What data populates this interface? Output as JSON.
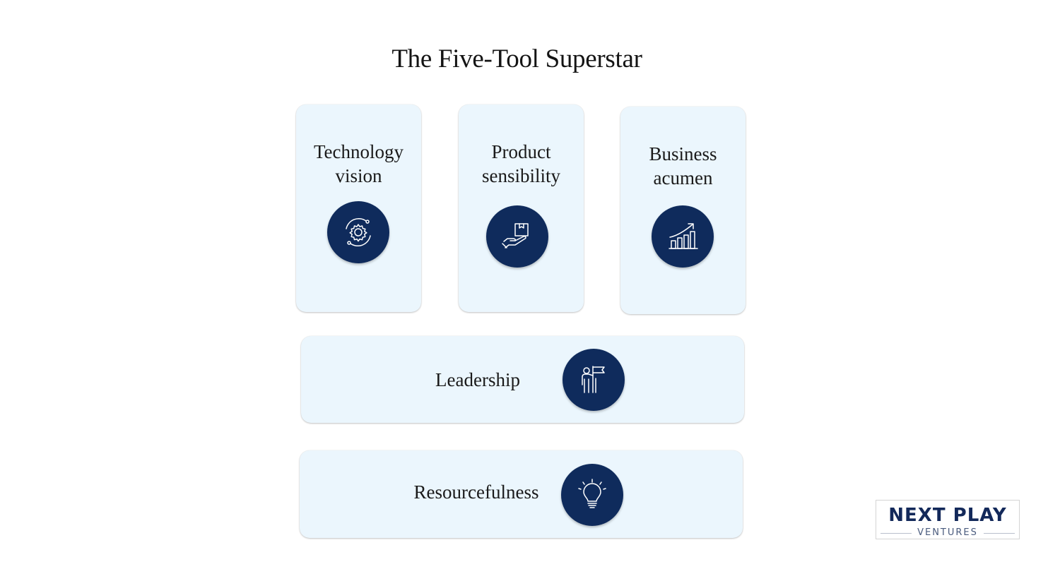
{
  "title": "The Five-Tool Superstar",
  "cards": [
    {
      "label": "Technology\nvision",
      "icon": "gear-cycle-icon"
    },
    {
      "label": "Product\nsensibility",
      "icon": "hand-box-icon"
    },
    {
      "label": "Business\nacumen",
      "icon": "growth-chart-icon"
    },
    {
      "label": "Leadership",
      "icon": "person-flag-icon"
    },
    {
      "label": "Resourcefulness",
      "icon": "lightbulb-icon"
    }
  ],
  "logo": {
    "main": "NEXT PLAY",
    "sub": "VENTURES"
  },
  "colors": {
    "card_bg": "#ebf6fd",
    "icon_circle": "#0f2b5c",
    "logo_text": "#13295a"
  }
}
